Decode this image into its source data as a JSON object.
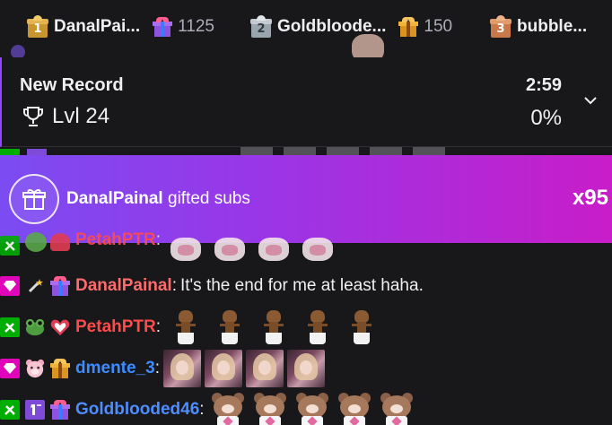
{
  "leaderboard": {
    "entries": [
      {
        "rank": "1",
        "name": "DanalPai...",
        "count": "1125",
        "rank_color": "#d9a84a",
        "gift_color": "#a35be8"
      },
      {
        "rank": "2",
        "name": "Goldbloode...",
        "count": "150",
        "rank_color": "#b9c2c9",
        "gift_color": "#e4a32a"
      },
      {
        "rank": "3",
        "name": "bubble...",
        "count": "",
        "rank_color": "#d98f5f",
        "gift_color": ""
      }
    ]
  },
  "record": {
    "title": "New Record",
    "level": "Lvl 24",
    "time_left": "2:59",
    "progress": "0%"
  },
  "gift_banner": {
    "gifter": "DanalPainal",
    "text": "gifted subs",
    "count": "x95"
  },
  "chat": [
    {
      "username": "PetahPTR",
      "color": "#ff4a4a",
      "message": "",
      "emote": "bunny",
      "emote_count": 4
    },
    {
      "username": "DanalPainal",
      "color": "#ff6b6b",
      "message": "It's the end for me at least haha.",
      "emote": "",
      "emote_count": 0
    },
    {
      "username": "PetahPTR",
      "color": "#ff4a4a",
      "message": "",
      "emote": "groot",
      "emote_count": 5
    },
    {
      "username": "dmente_3",
      "color": "#3d8cff",
      "message": "",
      "emote": "photo",
      "emote_count": 4
    },
    {
      "username": "Goldblooded46",
      "color": "#4d8dff",
      "message": "",
      "emote": "bear",
      "emote_count": 5
    }
  ],
  "colors": {
    "background": "#18181b",
    "accent": "#9147ff",
    "banner_gradient_start": "#7b4cf2",
    "banner_gradient_end": "#c81dc8",
    "mod_badge": "#00ad03",
    "vip_badge": "#e005b9",
    "sub_badge": "#7e4bd8"
  },
  "icons": {
    "trophy": "trophy-icon",
    "chevron": "chevron-down-icon",
    "gift": "gift-icon",
    "mod": "sword-icon",
    "vip": "diamond-icon"
  }
}
